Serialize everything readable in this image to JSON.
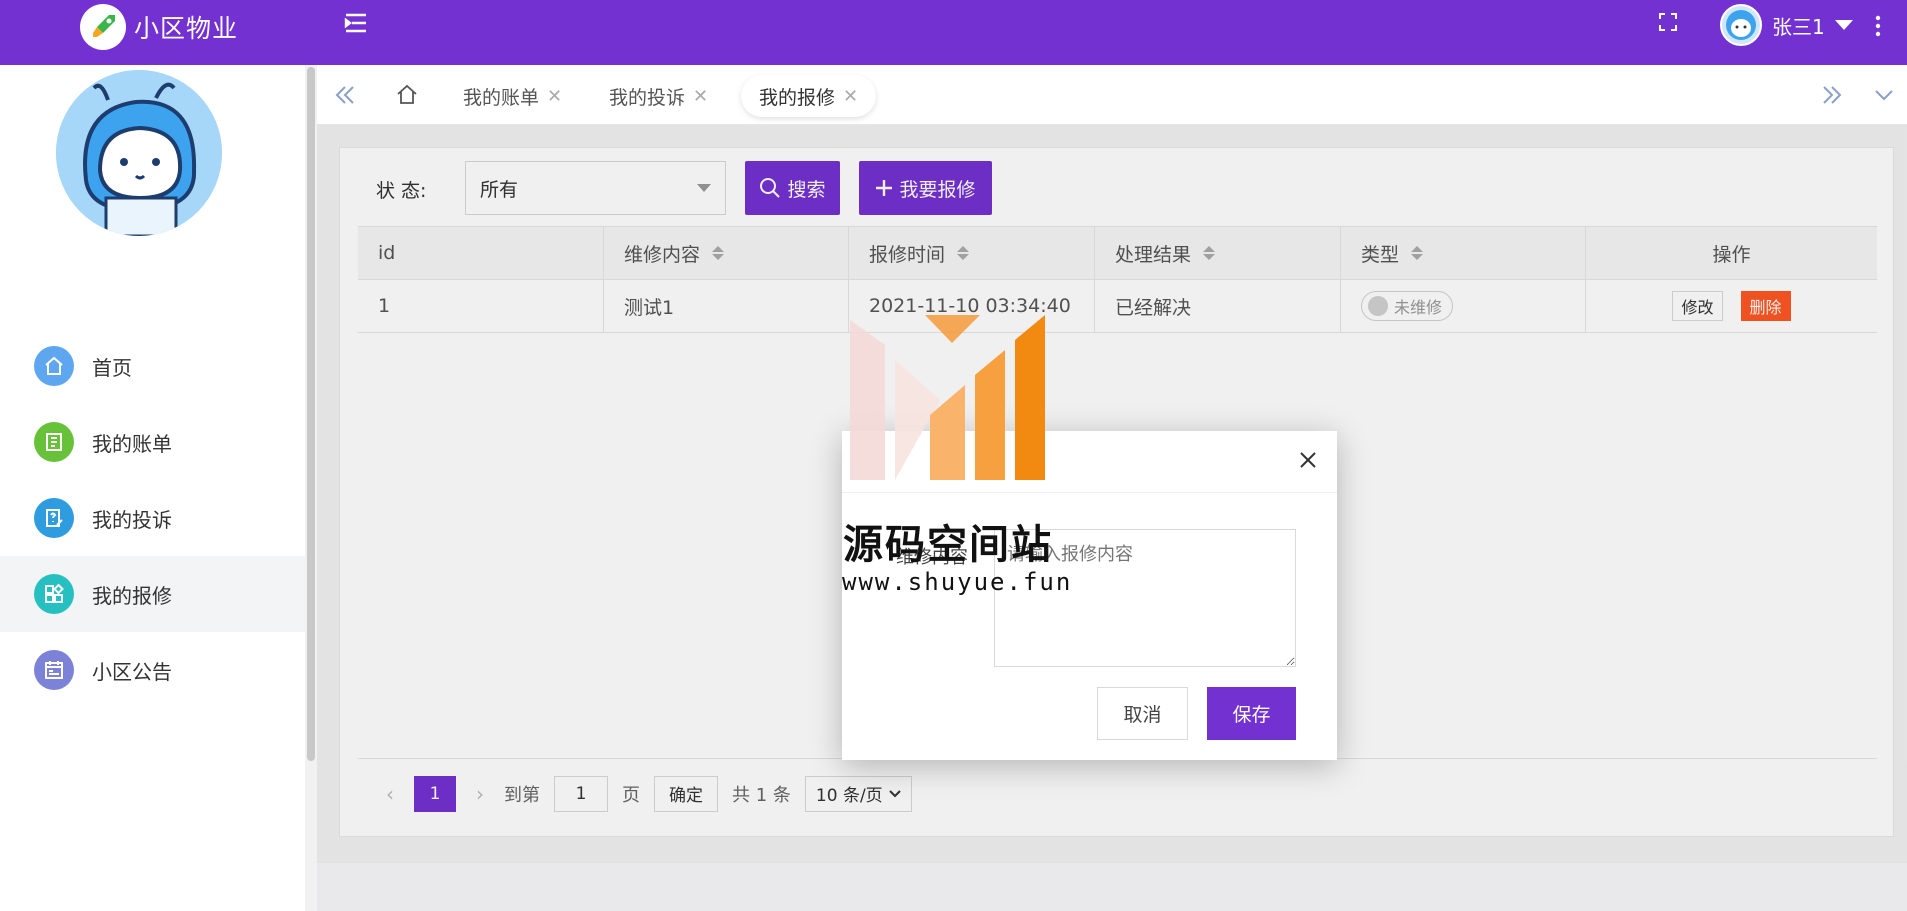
{
  "app": {
    "brand": "小区物业"
  },
  "user": {
    "name": "张三1"
  },
  "sidebar": {
    "items": [
      {
        "label": "首页",
        "icon": "home-icon",
        "color": "#5ea6f0"
      },
      {
        "label": "我的账单",
        "icon": "bill-icon",
        "color": "#67c23a"
      },
      {
        "label": "我的投诉",
        "icon": "complaint-icon",
        "color": "#2f9ce0"
      },
      {
        "label": "我的报修",
        "icon": "repair-icon",
        "color": "#26c0c0"
      },
      {
        "label": "小区公告",
        "icon": "notice-icon",
        "color": "#7b82d8"
      }
    ]
  },
  "tabs": [
    {
      "label": "我的账单"
    },
    {
      "label": "我的投诉"
    },
    {
      "label": "我的报修"
    }
  ],
  "filter": {
    "status_label": "状 态:",
    "status_value": "所有",
    "search_label": "搜索",
    "add_label": "我要报修"
  },
  "table": {
    "headers": [
      "id",
      "维修内容",
      "报修时间",
      "处理结果",
      "类型",
      "操作"
    ],
    "rows": [
      {
        "id": "1",
        "content": "测试1",
        "time": "2021-11-10 03:34:40",
        "result": "已经解决",
        "type": "未维修",
        "edit": "修改",
        "delete": "删除"
      }
    ]
  },
  "pager": {
    "current": "1",
    "goto_label": "到第",
    "page_input": "1",
    "page_unit": "页",
    "confirm": "确定",
    "total": "共 1 条",
    "page_size": "10 条/页"
  },
  "modal": {
    "field_label": "维修内容",
    "placeholder": "请输入报修内容",
    "cancel": "取消",
    "save": "保存"
  },
  "watermark": {
    "title": "源码空间站",
    "url": "www.shuyue.fun"
  },
  "colors": {
    "primary": "#7431d2",
    "danger": "#ff5722"
  }
}
